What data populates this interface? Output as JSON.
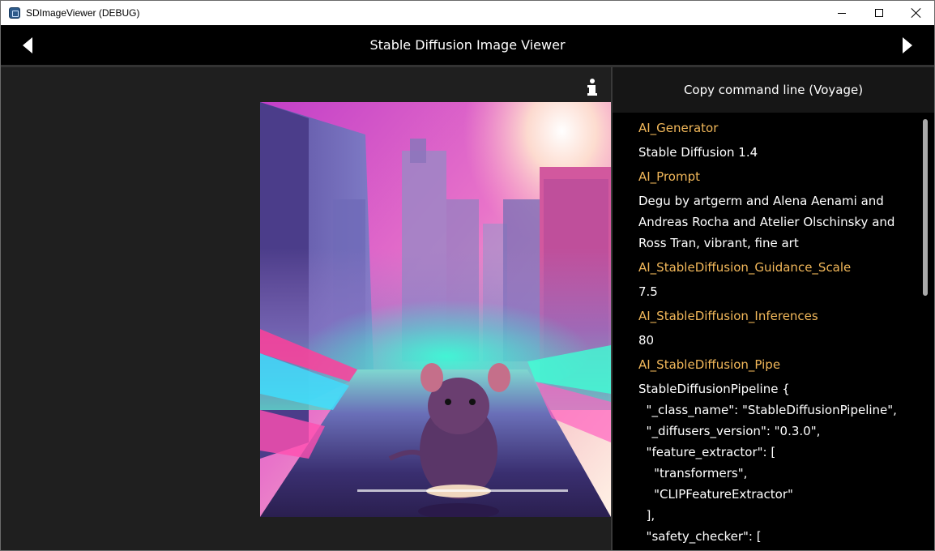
{
  "window": {
    "title": "SDImageViewer (DEBUG)"
  },
  "header": {
    "title": "Stable Diffusion Image Viewer"
  },
  "panel": {
    "copy_button": "Copy command line (Voyage)",
    "metadata": [
      {
        "key": "AI_Generator",
        "value": "Stable Diffusion 1.4"
      },
      {
        "key": "AI_Prompt",
        "value": "Degu by artgerm and Alena Aenami and\nAndreas Rocha and Atelier Olschinsky and\nRoss Tran, vibrant, fine art"
      },
      {
        "key": "AI_StableDiffusion_Guidance_Scale",
        "value": "7.5"
      },
      {
        "key": "AI_StableDiffusion_Inferences",
        "value": "80"
      },
      {
        "key": "AI_StableDiffusion_Pipe",
        "value": "StableDiffusionPipeline {\n  \"_class_name\": \"StableDiffusionPipeline\",\n  \"_diffusers_version\": \"0.3.0\",\n  \"feature_extractor\": [\n    \"transformers\",\n    \"CLIPFeatureExtractor\"\n  ],\n  \"safety_checker\": ["
      }
    ]
  },
  "icons": {
    "prev": "arrow-left-icon",
    "next": "arrow-right-icon",
    "info": "info-icon",
    "app": "app-icon"
  },
  "colors": {
    "header_bg": "#000000",
    "panel_bg": "#000000",
    "main_bg": "#1f1f1f",
    "key_text": "#f2b85a",
    "value_text": "#ffffff"
  }
}
